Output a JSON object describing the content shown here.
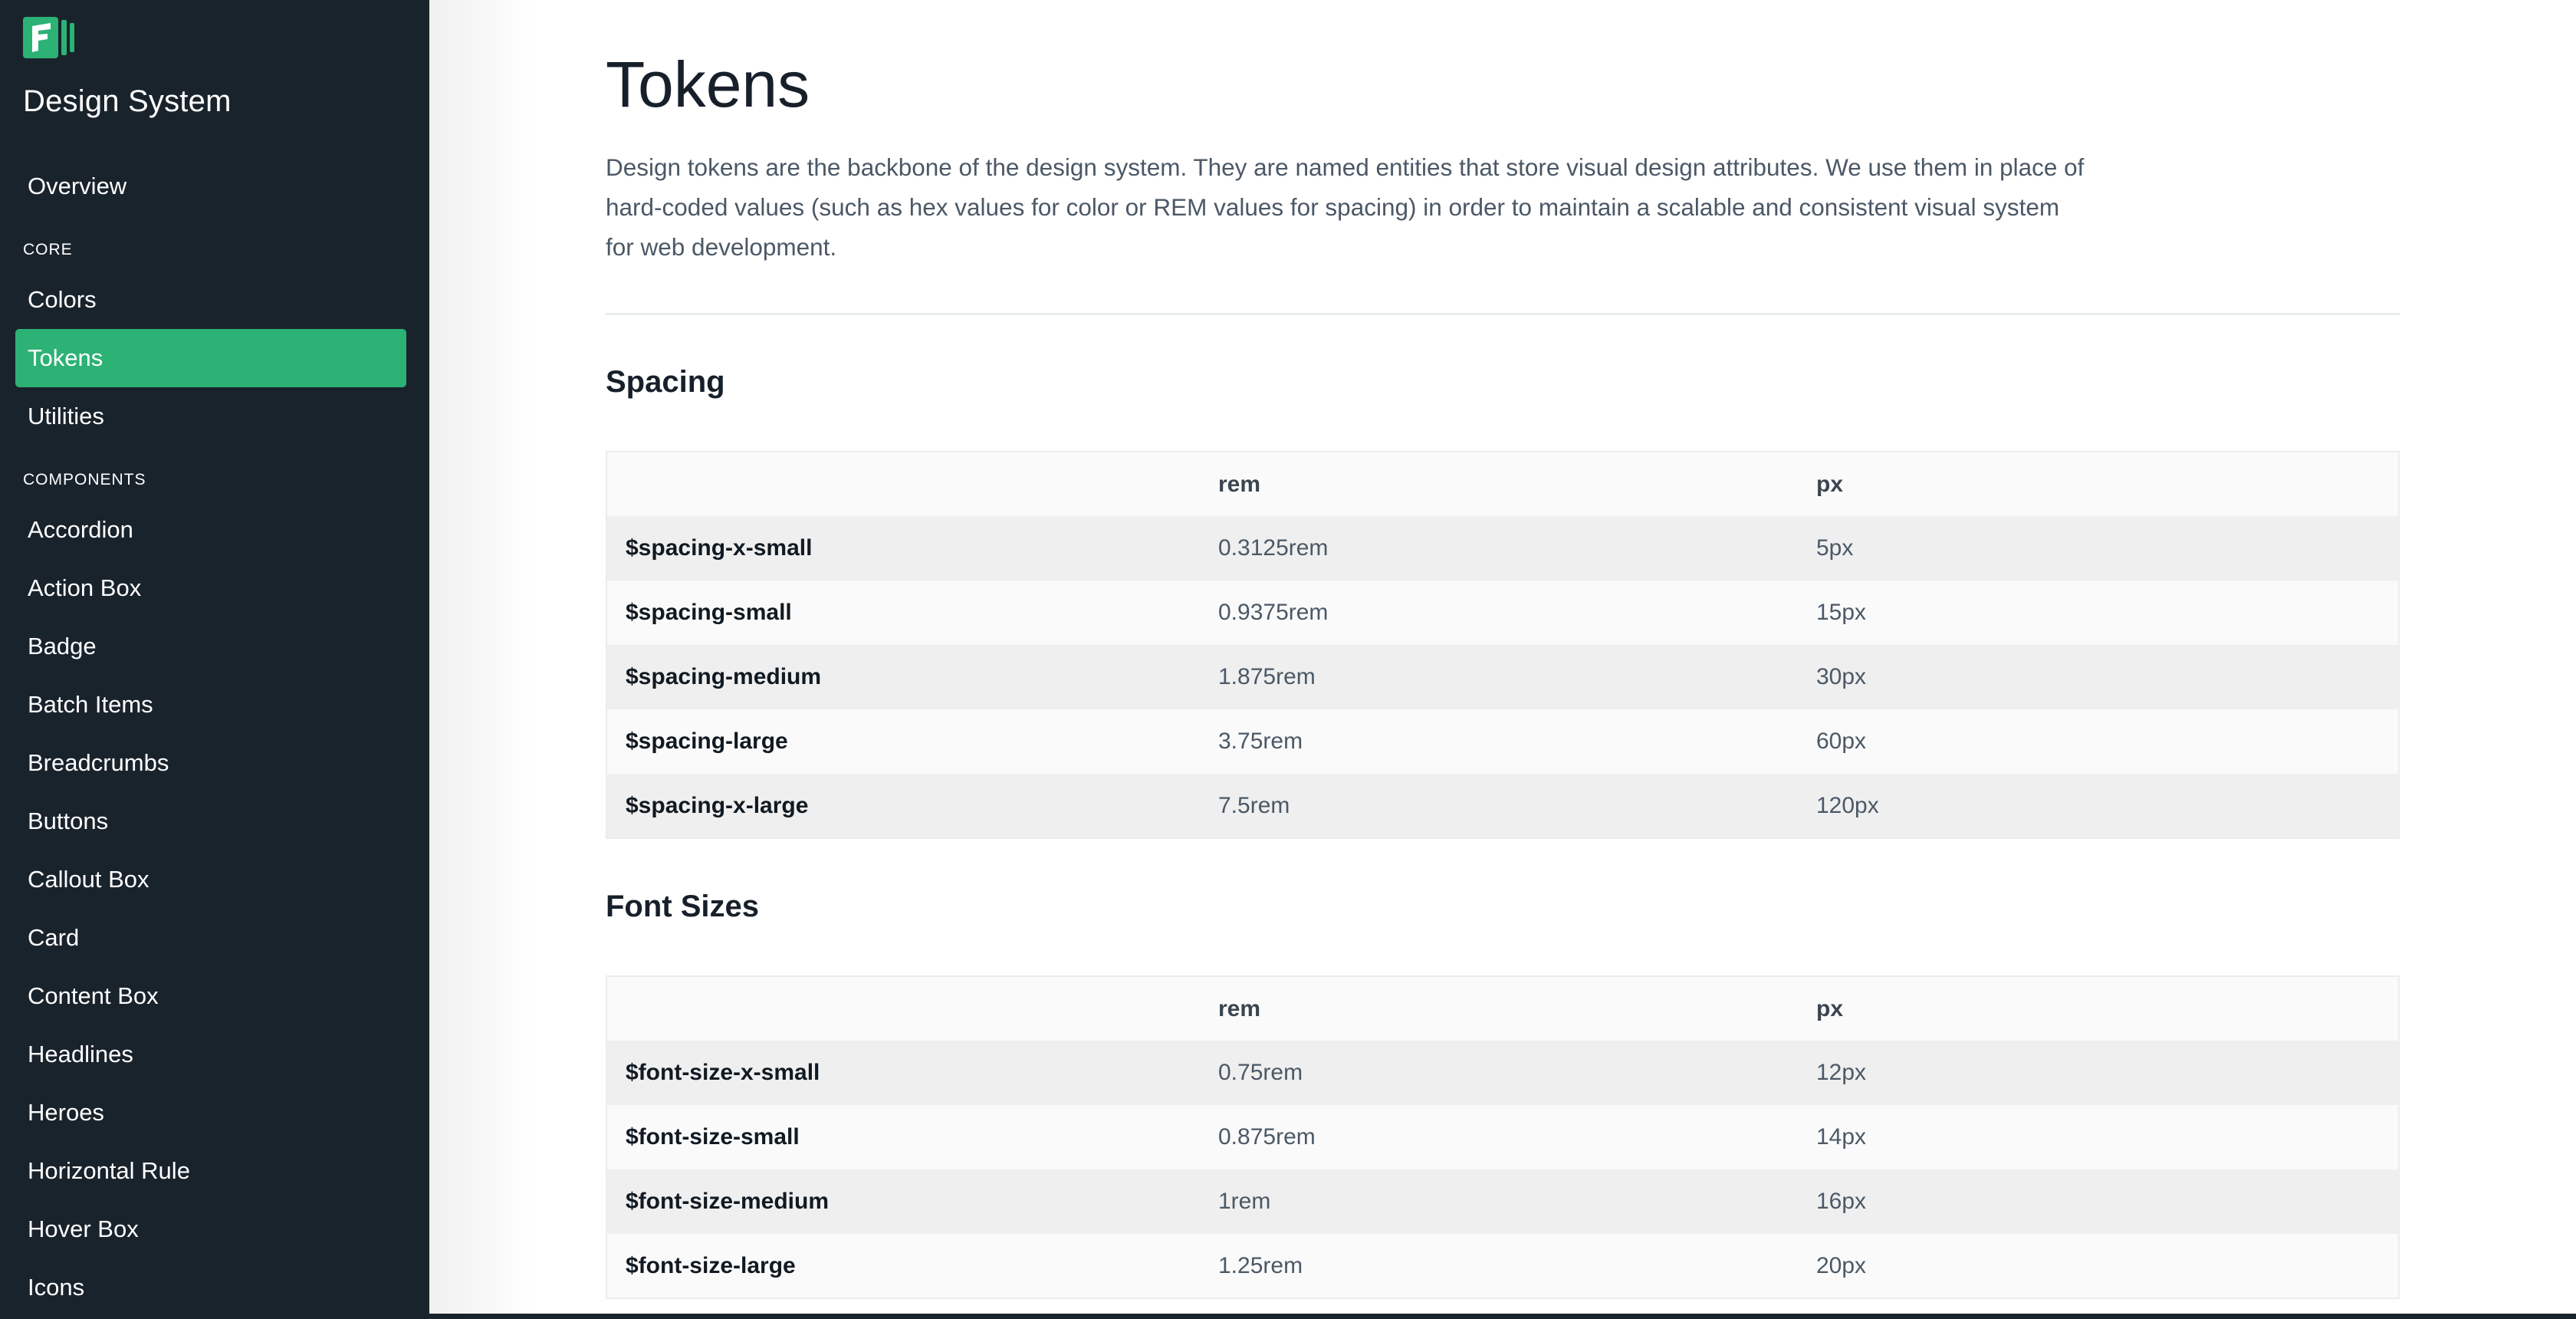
{
  "brand": {
    "name": "Design System",
    "logo_icon": "brand-logo-icon",
    "accent": "#2cb275"
  },
  "sidebar": {
    "overview": "Overview",
    "sections": [
      {
        "label": "Core",
        "items": [
          "Colors",
          "Tokens",
          "Utilities"
        ]
      },
      {
        "label": "Components",
        "items": [
          "Accordion",
          "Action Box",
          "Badge",
          "Batch Items",
          "Breadcrumbs",
          "Buttons",
          "Callout Box",
          "Card",
          "Content Box",
          "Headlines",
          "Heroes",
          "Horizontal Rule",
          "Hover Box",
          "Icons"
        ]
      }
    ],
    "active": "Tokens"
  },
  "main": {
    "title": "Tokens",
    "intro": "Design tokens are the backbone of the design system. They are named entities that store visual design attributes. We use them in place of hard-coded values (such as hex values for color or REM values for spacing) in order to maintain a scalable and consistent visual system for web development.",
    "intro_lines": [
      "Design tokens are the backbone of the design system. They are named entities that store visual design attributes. We use them in place of",
      "hard-coded values (such as hex values for color or REM values for spacing) in order to maintain a scalable and consistent visual system",
      "for web development."
    ],
    "tables": [
      {
        "title": "Spacing",
        "headers": [
          "",
          "rem",
          "px"
        ],
        "rows": [
          [
            "$spacing-x-small",
            "0.3125rem",
            "5px"
          ],
          [
            "$spacing-small",
            "0.9375rem",
            "15px"
          ],
          [
            "$spacing-medium",
            "1.875rem",
            "30px"
          ],
          [
            "$spacing-large",
            "3.75rem",
            "60px"
          ],
          [
            "$spacing-x-large",
            "7.5rem",
            "120px"
          ]
        ]
      },
      {
        "title": "Font Sizes",
        "headers": [
          "",
          "rem",
          "px"
        ],
        "rows": [
          [
            "$font-size-x-small",
            "0.75rem",
            "12px"
          ],
          [
            "$font-size-small",
            "0.875rem",
            "14px"
          ],
          [
            "$font-size-medium",
            "1rem",
            "16px"
          ],
          [
            "$font-size-large",
            "1.25rem",
            "20px"
          ]
        ]
      }
    ]
  }
}
